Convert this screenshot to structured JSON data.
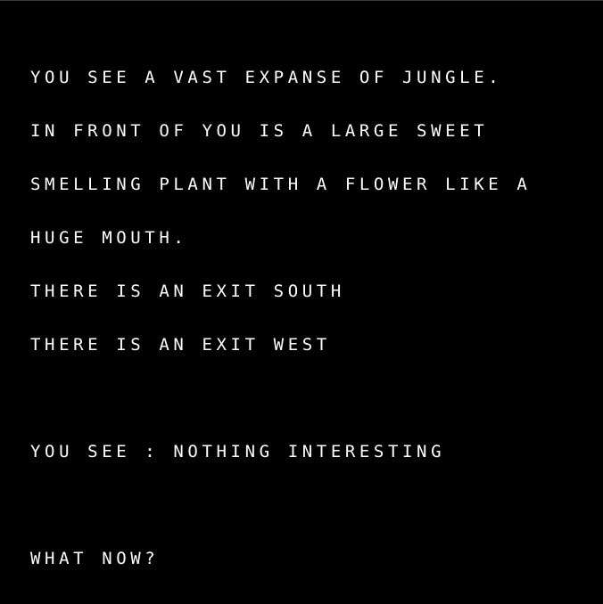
{
  "description": {
    "lines": [
      "YOU SEE A VAST EXPANSE OF JUNGLE.",
      "IN FRONT OF YOU IS A LARGE SWEET",
      "SMELLING PLANT WITH A FLOWER LIKE A",
      "HUGE MOUTH."
    ]
  },
  "exits": [
    "THERE IS AN EXIT SOUTH",
    "THERE IS AN EXIT WEST"
  ],
  "items": {
    "text": "YOU SEE : NOTHING INTERESTING"
  },
  "prompt": {
    "text": "WHAT NOW?"
  },
  "colors": {
    "background": "#000000",
    "text": "#ffffff"
  }
}
